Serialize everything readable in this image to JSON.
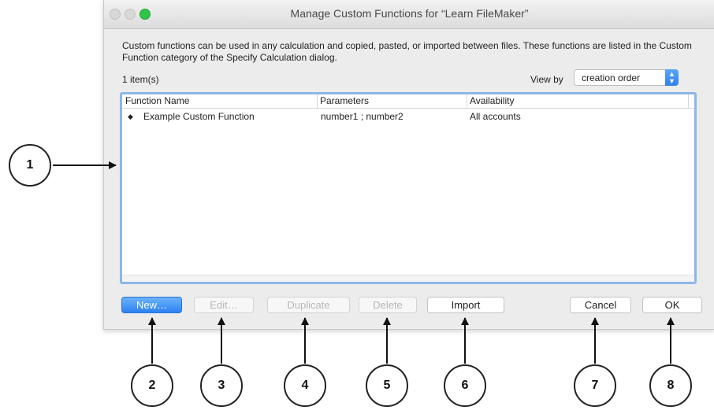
{
  "window": {
    "title": "Manage Custom Functions for “Learn FileMaker”",
    "description": "Custom functions can be used in any calculation and copied, pasted, or imported between files. These functions are listed in the Custom Function category of the Specify Calculation dialog.",
    "item_count": "1 item(s)",
    "view_by_label": "View by",
    "view_by_value": "creation order",
    "colors": {
      "accent": "#2d82f2",
      "selection_border": "#8cb7e8",
      "close_green": "#2fc447"
    }
  },
  "table": {
    "columns": [
      "Function Name",
      "Parameters",
      "Availability"
    ],
    "rows": [
      {
        "name": "Example Custom Function",
        "parameters": "number1 ; number2",
        "availability": "All accounts"
      }
    ]
  },
  "buttons": {
    "new": "New…",
    "edit": "Edit…",
    "duplicate": "Duplicate",
    "delete": "Delete",
    "import": "Import",
    "cancel": "Cancel",
    "ok": "OK"
  },
  "callouts": [
    "1",
    "2",
    "3",
    "4",
    "5",
    "6",
    "7",
    "8"
  ]
}
